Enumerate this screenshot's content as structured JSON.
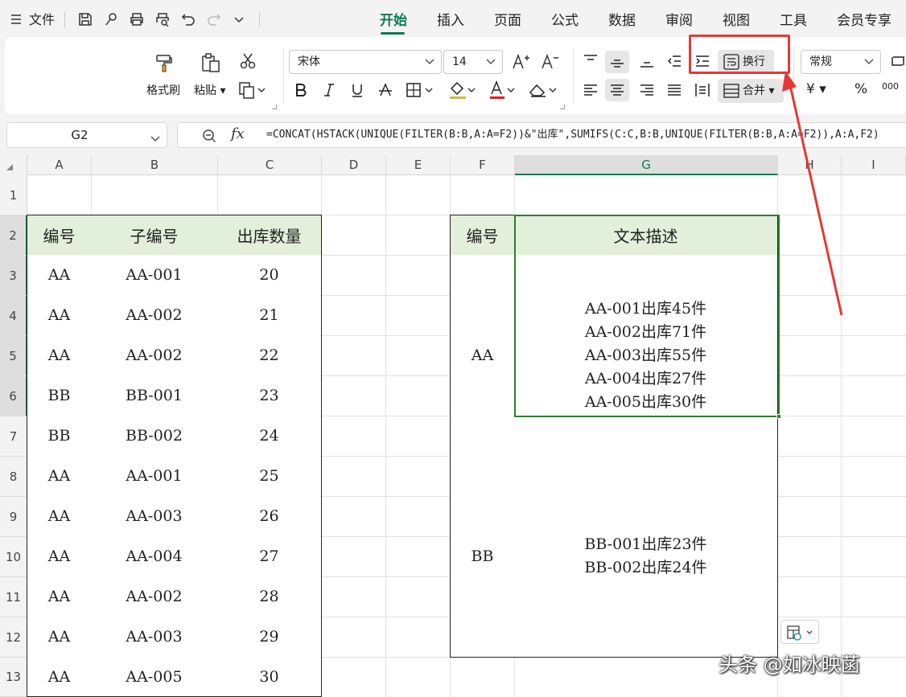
{
  "menubar": {
    "file_label": "文件",
    "tabs": [
      {
        "label": "开始",
        "active": true
      },
      {
        "label": "插入"
      },
      {
        "label": "页面"
      },
      {
        "label": "公式"
      },
      {
        "label": "数据"
      },
      {
        "label": "审阅"
      },
      {
        "label": "视图"
      },
      {
        "label": "工具"
      },
      {
        "label": "会员专享"
      }
    ]
  },
  "ribbon": {
    "format_painter": "格式刷",
    "paste": "粘贴",
    "font_name": "宋体",
    "font_size": "14",
    "wrap_text": "换行",
    "merge": "合并",
    "number_format": "常规",
    "currency_symbol": "¥",
    "percent_symbol": "%",
    "thousands_symbol": "000"
  },
  "formula_bar": {
    "cell_ref": "G2",
    "fx": "fx",
    "formula": "=CONCAT(HSTACK(UNIQUE(FILTER(B:B,A:A=F2))&\"出库\",SUMIFS(C:C,B:B,UNIQUE(FILTER(B:B,A:A=F2)),A:A,F2)"
  },
  "sheet": {
    "columns": [
      "A",
      "B",
      "C",
      "D",
      "E",
      "F",
      "G",
      "H",
      "I"
    ],
    "selected_column": "G",
    "rows": [
      "1",
      "2",
      "3",
      "4",
      "5",
      "6",
      "7",
      "8",
      "9",
      "10",
      "11",
      "12",
      "13"
    ],
    "table1": {
      "headers": [
        "编号",
        "子编号",
        "出库数量"
      ],
      "rows": [
        [
          "AA",
          "AA-001",
          "20"
        ],
        [
          "AA",
          "AA-002",
          "21"
        ],
        [
          "AA",
          "AA-002",
          "22"
        ],
        [
          "BB",
          "BB-001",
          "23"
        ],
        [
          "BB",
          "BB-002",
          "24"
        ],
        [
          "AA",
          "AA-001",
          "25"
        ],
        [
          "AA",
          "AA-003",
          "26"
        ],
        [
          "AA",
          "AA-004",
          "27"
        ],
        [
          "AA",
          "AA-002",
          "28"
        ],
        [
          "AA",
          "AA-003",
          "29"
        ],
        [
          "AA",
          "AA-005",
          "30"
        ]
      ]
    },
    "table2": {
      "headers": [
        "编号",
        "文本描述"
      ],
      "rows": [
        {
          "code": "AA",
          "lines": [
            "AA-001出库45件",
            "AA-002出库71件",
            "AA-003出库55件",
            "AA-004出库27件",
            "AA-005出库30件"
          ]
        },
        {
          "code": "BB",
          "lines": [
            "BB-001出库23件",
            "BB-002出库24件"
          ]
        }
      ]
    }
  },
  "watermark": "头条 @如冰映菡",
  "colors": {
    "accent": "#107a52",
    "header_fill": "#e2efda",
    "selection": "#2e7d32",
    "annotation": "#e53935"
  }
}
